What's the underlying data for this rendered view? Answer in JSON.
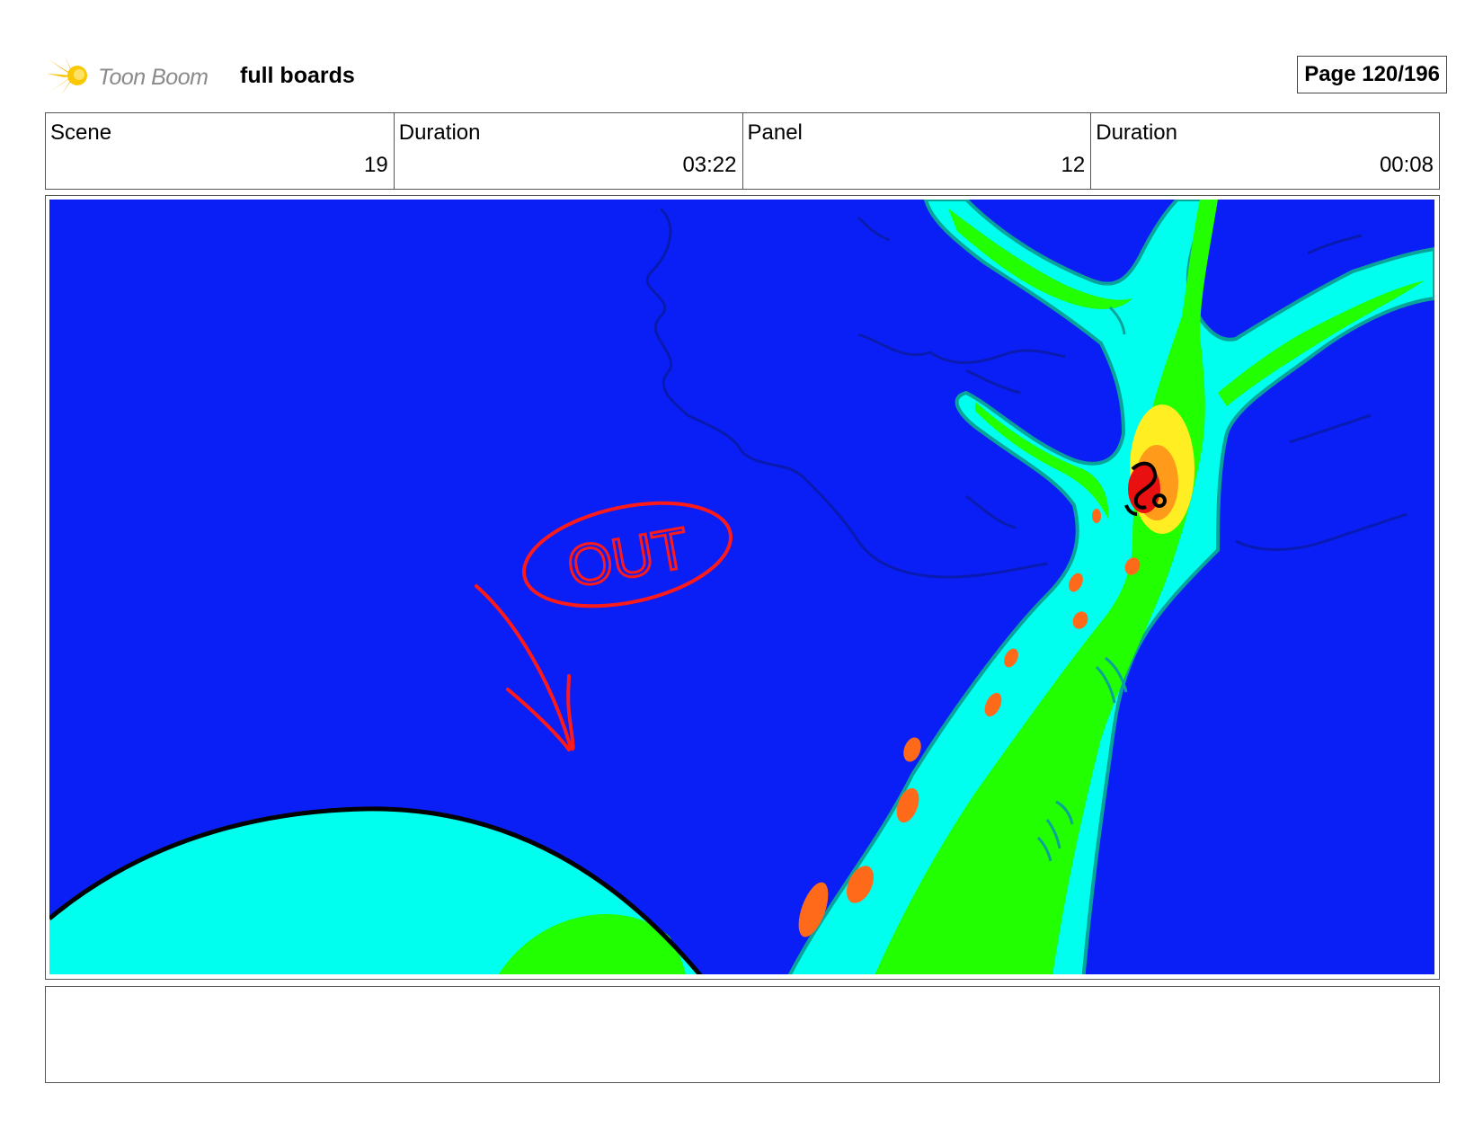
{
  "header": {
    "logo_text": "Toon Boom",
    "project_title": "full boards",
    "page_label": "Page 120/196"
  },
  "info": [
    {
      "label": "Scene",
      "value": "19"
    },
    {
      "label": "Duration",
      "value": "03:22"
    },
    {
      "label": "Panel",
      "value": "12"
    },
    {
      "label": "Duration",
      "value": "00:08"
    }
  ],
  "panel": {
    "annotation_text": "OUT",
    "colors": {
      "sky": "#0a1ff5",
      "cyan": "#00ffee",
      "green": "#22ff00",
      "yellow": "#ffee22",
      "orange": "#ff6a1a",
      "red": "#e81010",
      "annotation": "#ff1a1a"
    }
  },
  "notes": {
    "text": ""
  }
}
